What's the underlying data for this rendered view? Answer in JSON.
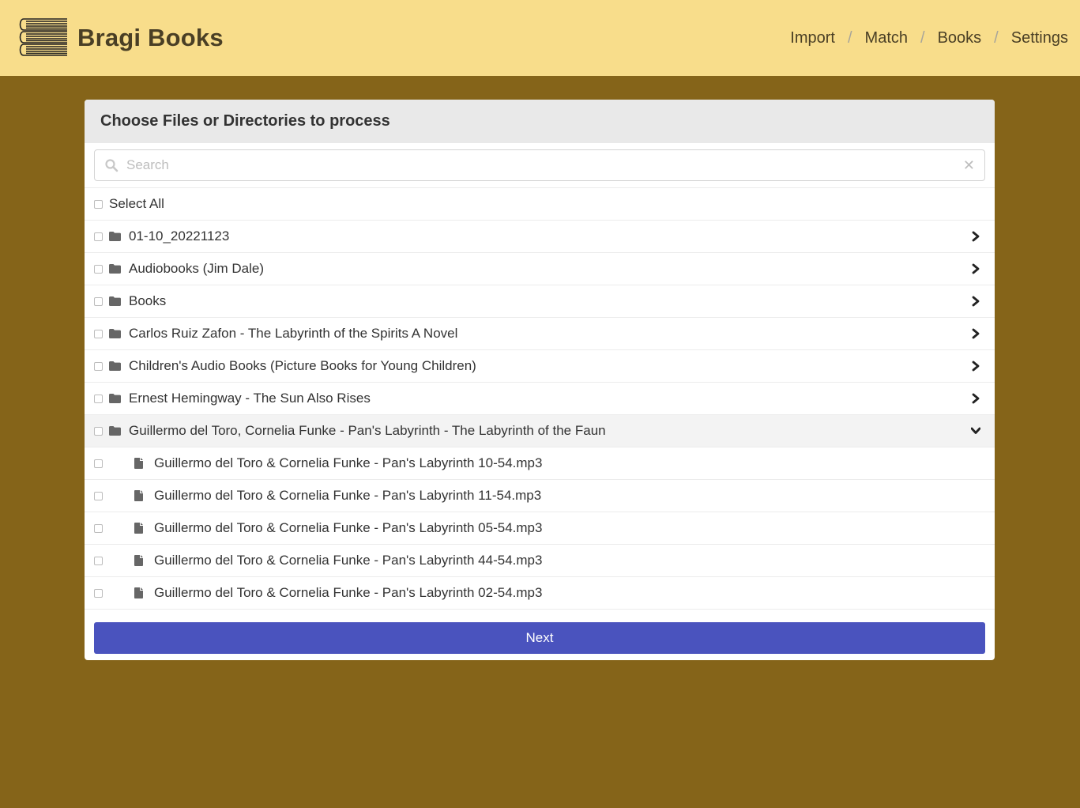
{
  "app": {
    "title": "Bragi Books"
  },
  "nav": {
    "items": [
      {
        "label": "Import"
      },
      {
        "label": "Match"
      },
      {
        "label": "Books"
      },
      {
        "label": "Settings"
      }
    ],
    "separator": "/"
  },
  "card": {
    "title": "Choose Files or Directories to process",
    "search": {
      "placeholder": "Search",
      "value": ""
    },
    "select_all_label": "Select All",
    "folders": [
      {
        "name": "01-10_20221123",
        "expanded": false
      },
      {
        "name": "Audiobooks (Jim Dale)",
        "expanded": false
      },
      {
        "name": "Books",
        "expanded": false
      },
      {
        "name": "Carlos Ruiz Zafon - The Labyrinth of the Spirits A Novel",
        "expanded": false
      },
      {
        "name": "Children's Audio Books (Picture Books for Young Children)",
        "expanded": false
      },
      {
        "name": "Ernest Hemingway - The Sun Also Rises",
        "expanded": false
      },
      {
        "name": "Guillermo del Toro, Cornelia Funke - Pan's Labyrinth - The Labyrinth of the Faun",
        "expanded": true
      }
    ],
    "files": [
      {
        "name": "Guillermo del Toro & Cornelia Funke - Pan's Labyrinth 10-54.mp3"
      },
      {
        "name": "Guillermo del Toro & Cornelia Funke - Pan's Labyrinth 11-54.mp3"
      },
      {
        "name": "Guillermo del Toro & Cornelia Funke - Pan's Labyrinth 05-54.mp3"
      },
      {
        "name": "Guillermo del Toro & Cornelia Funke - Pan's Labyrinth 44-54.mp3"
      },
      {
        "name": "Guillermo del Toro & Cornelia Funke - Pan's Labyrinth 02-54.mp3"
      }
    ],
    "next_label": "Next"
  },
  "colors": {
    "navbar_bg": "#f8dd8b",
    "page_bg": "#856419",
    "primary_button": "#4a53be"
  }
}
